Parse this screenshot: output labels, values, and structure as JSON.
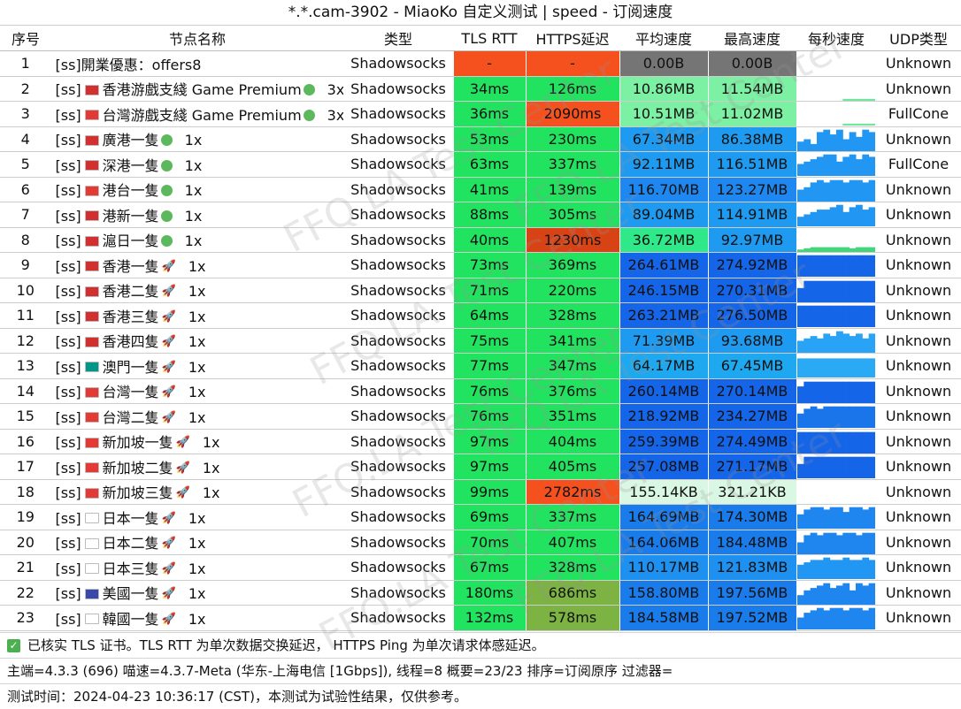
{
  "window": {
    "title": "*.*.cam-3902 - MiaoKo 自定义测试 | speed - 订阅速度"
  },
  "columns": [
    "序号",
    "节点名称",
    "类型",
    "TLS RTT",
    "HTTPS延迟",
    "平均速度",
    "最高速度",
    "每秒速度",
    "UDP类型"
  ],
  "rows": [
    {
      "idx": "1",
      "name": "[ss]開業優惠：offers8",
      "flag": "",
      "suffix": "",
      "mult": "",
      "type": "Shadowsocks",
      "tls": "-",
      "https": "-",
      "avg": "0.00B",
      "max": "0.00B",
      "udp": "Unknown",
      "tls_color": "#f4511e",
      "https_color": "#f4511e",
      "avg_color": "#757575",
      "max_color": "#757575",
      "graph": [],
      "graph_color": "#ffffff"
    },
    {
      "idx": "2",
      "name": "[ss]",
      "flag": "#d32f2f",
      "label": "香港游戲支綫 Game Premium",
      "suffix": "dot",
      "mult": "3x",
      "type": "Shadowsocks",
      "tls": "34ms",
      "https": "126ms",
      "avg": "10.86MB",
      "max": "11.54MB",
      "udp": "Unknown",
      "tls_color": "#22e35f",
      "https_color": "#22e35f",
      "avg_color": "#7cf0a3",
      "max_color": "#7cf0a3",
      "graph": [
        0,
        0,
        0,
        0,
        0,
        0,
        0,
        0.08,
        0.08,
        0.08,
        0.08,
        0.08
      ],
      "graph_color": "#72e59a"
    },
    {
      "idx": "3",
      "name": "[ss]",
      "flag": "#e53935",
      "label": "台灣游戲支綫 Game Premium",
      "suffix": "dot",
      "mult": "3x",
      "type": "Shadowsocks",
      "tls": "36ms",
      "https": "2090ms",
      "avg": "10.51MB",
      "max": "11.02MB",
      "udp": "FullCone",
      "tls_color": "#22e35f",
      "https_color": "#f4511e",
      "avg_color": "#7cf0a3",
      "max_color": "#7cf0a3",
      "graph": [
        0,
        0,
        0,
        0,
        0,
        0,
        0,
        0.08,
        0.08,
        0.08,
        0.08,
        0.08
      ],
      "graph_color": "#72e59a"
    },
    {
      "idx": "4",
      "name": "[ss]",
      "flag": "#d32f2f",
      "label": "廣港一隻",
      "suffix": "dot",
      "mult": "1x",
      "type": "Shadowsocks",
      "tls": "53ms",
      "https": "230ms",
      "avg": "67.34MB",
      "max": "86.38MB",
      "udp": "Unknown",
      "tls_color": "#22e35f",
      "https_color": "#22e35f",
      "avg_color": "#1e9bf0",
      "max_color": "#1e9bf0",
      "graph": [
        0.4,
        0.5,
        0.3,
        0.8,
        0.9,
        0.7,
        0.9,
        0.5,
        0.8,
        0.6,
        0.9,
        0.8
      ],
      "graph_color": "#2196f3"
    },
    {
      "idx": "5",
      "name": "[ss]",
      "flag": "#d32f2f",
      "label": "深港一隻",
      "suffix": "dot",
      "mult": "1x",
      "type": "Shadowsocks",
      "tls": "63ms",
      "https": "337ms",
      "avg": "92.11MB",
      "max": "116.51MB",
      "udp": "FullCone",
      "tls_color": "#22e35f",
      "https_color": "#22e35f",
      "avg_color": "#1e9bf0",
      "max_color": "#1e9bf0",
      "graph": [
        0.5,
        0.6,
        0.7,
        0.8,
        0.9,
        0.9,
        0.6,
        0.8,
        0.9,
        0.7,
        0.9,
        0.8
      ],
      "graph_color": "#2196f3"
    },
    {
      "idx": "6",
      "name": "[ss]",
      "flag": "#e53935",
      "label": "港台一隻",
      "suffix": "dot",
      "mult": "1x",
      "type": "Shadowsocks",
      "tls": "41ms",
      "https": "139ms",
      "avg": "116.70MB",
      "max": "123.27MB",
      "udp": "Unknown",
      "tls_color": "#22e35f",
      "https_color": "#22e35f",
      "avg_color": "#1e88f0",
      "max_color": "#1e88f0",
      "graph": [
        0.5,
        0.6,
        0.8,
        0.9,
        0.8,
        0.9,
        0.9,
        0.8,
        0.9,
        0.9,
        0.8,
        0.9
      ],
      "graph_color": "#2196f3"
    },
    {
      "idx": "7",
      "name": "[ss]",
      "flag": "#d32f2f",
      "label": "港新一隻",
      "suffix": "dot",
      "mult": "1x",
      "type": "Shadowsocks",
      "tls": "88ms",
      "https": "305ms",
      "avg": "89.04MB",
      "max": "114.91MB",
      "udp": "Unknown",
      "tls_color": "#22e35f",
      "https_color": "#22e35f",
      "avg_color": "#1e9bf0",
      "max_color": "#1e9bf0",
      "graph": [
        0.4,
        0.5,
        0.6,
        0.7,
        0.7,
        0.8,
        0.9,
        0.6,
        0.8,
        0.9,
        0.7,
        0.8
      ],
      "graph_color": "#2196f3"
    },
    {
      "idx": "8",
      "name": "[ss]",
      "flag": "#d32f2f",
      "label": "滬日一隻",
      "suffix": "dot",
      "mult": "1x",
      "type": "Shadowsocks",
      "tls": "40ms",
      "https": "1230ms",
      "avg": "36.72MB",
      "max": "92.97MB",
      "udp": "Unknown",
      "tls_color": "#22e35f",
      "https_color": "#d84315",
      "avg_color": "#2ee88a",
      "max_color": "#1e9bf0",
      "graph": [
        0.1,
        0.15,
        0.2,
        0.2,
        0.2,
        0.2,
        0.2,
        0.2,
        0.15,
        0.2,
        0.2,
        0.2
      ],
      "graph_color": "#42d67a"
    },
    {
      "idx": "9",
      "name": "[ss]",
      "flag": "#d32f2f",
      "label": "香港一隻",
      "suffix": "rocket",
      "mult": "1x",
      "type": "Shadowsocks",
      "tls": "73ms",
      "https": "369ms",
      "avg": "264.61MB",
      "max": "274.92MB",
      "udp": "Unknown",
      "tls_color": "#22e35f",
      "https_color": "#22e35f",
      "avg_color": "#1565e8",
      "max_color": "#1565e8",
      "graph": [
        0.9,
        0.9,
        0.9,
        0.9,
        0.9,
        0.9,
        0.9,
        0.9,
        0.9,
        0.9,
        0.9,
        0.9
      ],
      "graph_color": "#1565e8"
    },
    {
      "idx": "10",
      "name": "[ss]",
      "flag": "#d32f2f",
      "label": "香港二隻",
      "suffix": "rocket",
      "mult": "1x",
      "type": "Shadowsocks",
      "tls": "71ms",
      "https": "220ms",
      "avg": "246.15MB",
      "max": "270.31MB",
      "udp": "Unknown",
      "tls_color": "#22e35f",
      "https_color": "#22e35f",
      "avg_color": "#1565e8",
      "max_color": "#1565e8",
      "graph": [
        0.6,
        0.9,
        0.9,
        0.9,
        0.9,
        0.9,
        0.9,
        0.9,
        0.9,
        0.9,
        0.9,
        0.9
      ],
      "graph_color": "#1565e8"
    },
    {
      "idx": "11",
      "name": "[ss]",
      "flag": "#d32f2f",
      "label": "香港三隻",
      "suffix": "rocket",
      "mult": "1x",
      "type": "Shadowsocks",
      "tls": "64ms",
      "https": "328ms",
      "avg": "263.21MB",
      "max": "276.50MB",
      "udp": "Unknown",
      "tls_color": "#22e35f",
      "https_color": "#22e35f",
      "avg_color": "#1565e8",
      "max_color": "#1565e8",
      "graph": [
        0.9,
        0.9,
        0.9,
        0.9,
        0.9,
        0.9,
        0.9,
        0.9,
        0.9,
        0.9,
        0.9,
        0.9
      ],
      "graph_color": "#1565e8"
    },
    {
      "idx": "12",
      "name": "[ss]",
      "flag": "#d32f2f",
      "label": "香港四隻",
      "suffix": "rocket",
      "mult": "1x",
      "type": "Shadowsocks",
      "tls": "75ms",
      "https": "341ms",
      "avg": "71.39MB",
      "max": "93.68MB",
      "udp": "Unknown",
      "tls_color": "#22e35f",
      "https_color": "#22e35f",
      "avg_color": "#1e9bf0",
      "max_color": "#1e9bf0",
      "graph": [
        0.5,
        0.6,
        0.7,
        0.6,
        0.8,
        0.7,
        0.9,
        0.8,
        0.7,
        0.8,
        0.6,
        0.8
      ],
      "graph_color": "#29a3f5"
    },
    {
      "idx": "13",
      "name": "[ss]",
      "flag": "#009688",
      "label": "澳門一隻",
      "suffix": "rocket",
      "mult": "1x",
      "type": "Shadowsocks",
      "tls": "77ms",
      "https": "347ms",
      "avg": "64.17MB",
      "max": "67.45MB",
      "udp": "Unknown",
      "tls_color": "#22e35f",
      "https_color": "#22e35f",
      "avg_color": "#1ea8f0",
      "max_color": "#1ea8f0",
      "graph": [
        0.8,
        0.8,
        0.8,
        0.8,
        0.8,
        0.8,
        0.8,
        0.8,
        0.8,
        0.8,
        0.8,
        0.8
      ],
      "graph_color": "#2aaaf5"
    },
    {
      "idx": "14",
      "name": "[ss]",
      "flag": "#e53935",
      "label": "台灣一隻",
      "suffix": "rocket",
      "mult": "1x",
      "type": "Shadowsocks",
      "tls": "76ms",
      "https": "376ms",
      "avg": "260.14MB",
      "max": "270.14MB",
      "udp": "Unknown",
      "tls_color": "#22e35f",
      "https_color": "#22e35f",
      "avg_color": "#1565e8",
      "max_color": "#1565e8",
      "graph": [
        0.7,
        0.9,
        0.9,
        0.9,
        0.9,
        0.9,
        0.9,
        0.9,
        0.9,
        0.9,
        0.9,
        0.9
      ],
      "graph_color": "#1565e8"
    },
    {
      "idx": "15",
      "name": "[ss]",
      "flag": "#e53935",
      "label": "台灣二隻",
      "suffix": "rocket",
      "mult": "1x",
      "type": "Shadowsocks",
      "tls": "76ms",
      "https": "351ms",
      "avg": "218.92MB",
      "max": "234.27MB",
      "udp": "Unknown",
      "tls_color": "#22e35f",
      "https_color": "#22e35f",
      "avg_color": "#1565e8",
      "max_color": "#1565e8",
      "graph": [
        0.6,
        0.8,
        0.9,
        0.8,
        0.9,
        0.9,
        0.9,
        0.9,
        0.9,
        0.9,
        0.9,
        0.9
      ],
      "graph_color": "#1a74ea"
    },
    {
      "idx": "16",
      "name": "[ss]",
      "flag": "#e53935",
      "label": "新加坡一隻",
      "suffix": "rocket",
      "mult": "1x",
      "type": "Shadowsocks",
      "tls": "97ms",
      "https": "404ms",
      "avg": "259.39MB",
      "max": "274.49MB",
      "udp": "Unknown",
      "tls_color": "#22e35f",
      "https_color": "#22e35f",
      "avg_color": "#1565e8",
      "max_color": "#1565e8",
      "graph": [
        0.9,
        0.9,
        0.9,
        0.9,
        0.9,
        0.9,
        0.9,
        0.9,
        0.9,
        0.9,
        0.9,
        0.9
      ],
      "graph_color": "#1565e8"
    },
    {
      "idx": "17",
      "name": "[ss]",
      "flag": "#e53935",
      "label": "新加坡二隻",
      "suffix": "rocket",
      "mult": "1x",
      "type": "Shadowsocks",
      "tls": "97ms",
      "https": "405ms",
      "avg": "257.08MB",
      "max": "271.17MB",
      "udp": "Unknown",
      "tls_color": "#22e35f",
      "https_color": "#22e35f",
      "avg_color": "#1565e8",
      "max_color": "#1565e8",
      "graph": [
        0.6,
        0.9,
        0.9,
        0.9,
        0.9,
        0.9,
        0.9,
        0.9,
        0.9,
        0.9,
        0.9,
        0.9
      ],
      "graph_color": "#1565e8"
    },
    {
      "idx": "18",
      "name": "[ss]",
      "flag": "#e53935",
      "label": "新加坡三隻",
      "suffix": "rocket",
      "mult": "1x",
      "type": "Shadowsocks",
      "tls": "99ms",
      "https": "2782ms",
      "avg": "155.14KB",
      "max": "321.21KB",
      "udp": "Unknown",
      "tls_color": "#22e35f",
      "https_color": "#f4511e",
      "avg_color": "#d9f7e3",
      "max_color": "#d9f7e3",
      "graph": [],
      "graph_color": "#ffffff"
    },
    {
      "idx": "19",
      "name": "[ss]",
      "flag": "#ffffff",
      "label": "日本一隻",
      "suffix": "rocket",
      "mult": "1x",
      "type": "Shadowsocks",
      "tls": "69ms",
      "https": "337ms",
      "avg": "164.69MB",
      "max": "174.30MB",
      "udp": "Unknown",
      "tls_color": "#22e35f",
      "https_color": "#22e35f",
      "avg_color": "#1a7bea",
      "max_color": "#1a7bea",
      "graph": [
        0.6,
        0.8,
        0.9,
        0.9,
        0.8,
        0.9,
        0.9,
        0.7,
        0.9,
        0.9,
        0.8,
        0.9
      ],
      "graph_color": "#1f86ef"
    },
    {
      "idx": "20",
      "name": "[ss]",
      "flag": "#ffffff",
      "label": "日本二隻",
      "suffix": "rocket",
      "mult": "1x",
      "type": "Shadowsocks",
      "tls": "70ms",
      "https": "407ms",
      "avg": "164.06MB",
      "max": "184.48MB",
      "udp": "Unknown",
      "tls_color": "#22e35f",
      "https_color": "#22e35f",
      "avg_color": "#1a7bea",
      "max_color": "#1a7bea",
      "graph": [
        0.5,
        0.8,
        0.9,
        0.8,
        0.9,
        0.9,
        0.8,
        0.9,
        0.9,
        0.8,
        0.9,
        0.9
      ],
      "graph_color": "#1f86ef"
    },
    {
      "idx": "21",
      "name": "[ss]",
      "flag": "#ffffff",
      "label": "日本三隻",
      "suffix": "rocket",
      "mult": "1x",
      "type": "Shadowsocks",
      "tls": "67ms",
      "https": "328ms",
      "avg": "110.17MB",
      "max": "121.83MB",
      "udp": "Unknown",
      "tls_color": "#22e35f",
      "https_color": "#22e35f",
      "avg_color": "#1e90f0",
      "max_color": "#1e90f0",
      "graph": [
        0.6,
        0.7,
        0.8,
        0.8,
        0.9,
        0.8,
        0.8,
        0.9,
        0.8,
        0.8,
        0.9,
        0.8
      ],
      "graph_color": "#2196f3"
    },
    {
      "idx": "22",
      "name": "[ss]",
      "flag": "#3949ab",
      "label": "美國一隻",
      "suffix": "rocket",
      "mult": "1x",
      "type": "Shadowsocks",
      "tls": "180ms",
      "https": "686ms",
      "avg": "158.80MB",
      "max": "197.56MB",
      "udp": "Unknown",
      "tls_color": "#22e35f",
      "https_color": "#7cb342",
      "avg_color": "#1a7bea",
      "max_color": "#1a7bea",
      "graph": [
        0.4,
        0.6,
        0.7,
        0.8,
        0.9,
        0.7,
        0.8,
        0.9,
        0.6,
        0.9,
        0.8,
        0.9
      ],
      "graph_color": "#1f86ef"
    },
    {
      "idx": "23",
      "name": "[ss]",
      "flag": "#ffffff",
      "label": "韓國一隻",
      "suffix": "rocket",
      "mult": "1x",
      "type": "Shadowsocks",
      "tls": "132ms",
      "https": "578ms",
      "avg": "184.58MB",
      "max": "197.52MB",
      "udp": "Unknown",
      "tls_color": "#22e35f",
      "https_color": "#7cb342",
      "avg_color": "#1a7bea",
      "max_color": "#1a7bea",
      "graph": [
        0.5,
        0.7,
        0.8,
        0.9,
        0.8,
        0.9,
        0.9,
        0.8,
        0.9,
        0.9,
        0.8,
        0.9
      ],
      "graph_color": "#1f86ef"
    }
  ],
  "footer": {
    "line1": "已核实 TLS 证书。TLS RTT 为单次数据交换延迟， HTTPS Ping 为单次请求体感延迟。",
    "line2": "主端=4.3.3 (696) 喵速=4.3.7-Meta (华东-上海电信 [1Gbps]), 线程=8 概要=23/23 排序=订阅原序 过滤器=",
    "line3": "测试时间：2024-04-23 10:36:17 (CST)，本测试为试验性结果，仅供参考。"
  },
  "watermark": "FFQ.LA Test Center"
}
